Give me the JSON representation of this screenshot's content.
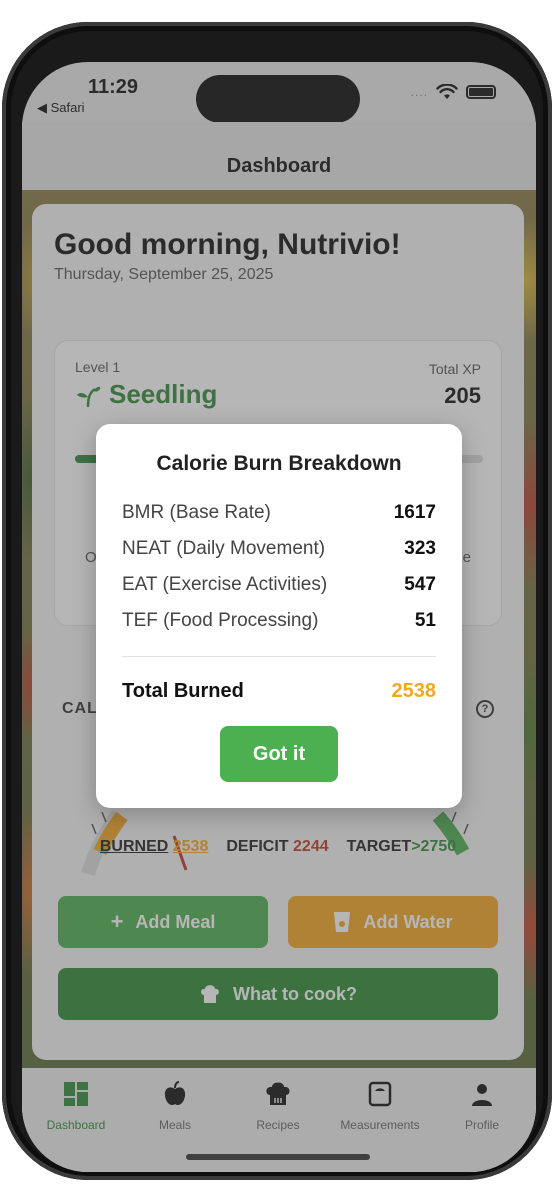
{
  "status": {
    "time": "11:29",
    "back_app": "◀ Safari",
    "signal_dots": "...."
  },
  "header": {
    "title": "Dashboard"
  },
  "greeting": {
    "title": "Good morning, Nutrivio!",
    "date": "Thursday, September 25, 2025"
  },
  "level": {
    "label": "Level 1",
    "name": "Seedling",
    "xp_label": "Total XP",
    "xp_value": "205",
    "progress_fraction": 0.2,
    "foot_left": "O",
    "foot_right": "e"
  },
  "calories": {
    "title": "CAL",
    "help": "?",
    "burned_label": "BURNED",
    "burned_value": "2538",
    "deficit_label": "DEFICIT",
    "deficit_value": "2244",
    "target_label": "TARGET",
    "target_value": ">2750"
  },
  "actions": {
    "add_meal": "Add Meal",
    "add_water": "Add Water",
    "what_to_cook": "What to cook?"
  },
  "tabs": [
    {
      "label": "Dashboard",
      "icon": "dashboard-icon"
    },
    {
      "label": "Meals",
      "icon": "apple-icon"
    },
    {
      "label": "Recipes",
      "icon": "chef-hat-icon"
    },
    {
      "label": "Measurements",
      "icon": "scale-icon"
    },
    {
      "label": "Profile",
      "icon": "person-icon"
    }
  ],
  "modal": {
    "title": "Calorie Burn Breakdown",
    "rows": [
      {
        "label": "BMR (Base Rate)",
        "value": "1617"
      },
      {
        "label": "NEAT (Daily Movement)",
        "value": "323"
      },
      {
        "label": "EAT (Exercise Activities)",
        "value": "547"
      },
      {
        "label": "TEF (Food Processing)",
        "value": "51"
      }
    ],
    "total_label": "Total Burned",
    "total_value": "2538",
    "button": "Got it"
  },
  "colors": {
    "green": "#4caf50",
    "dark_green": "#2e8b34",
    "orange": "#f5a623",
    "red": "#c0392b"
  }
}
